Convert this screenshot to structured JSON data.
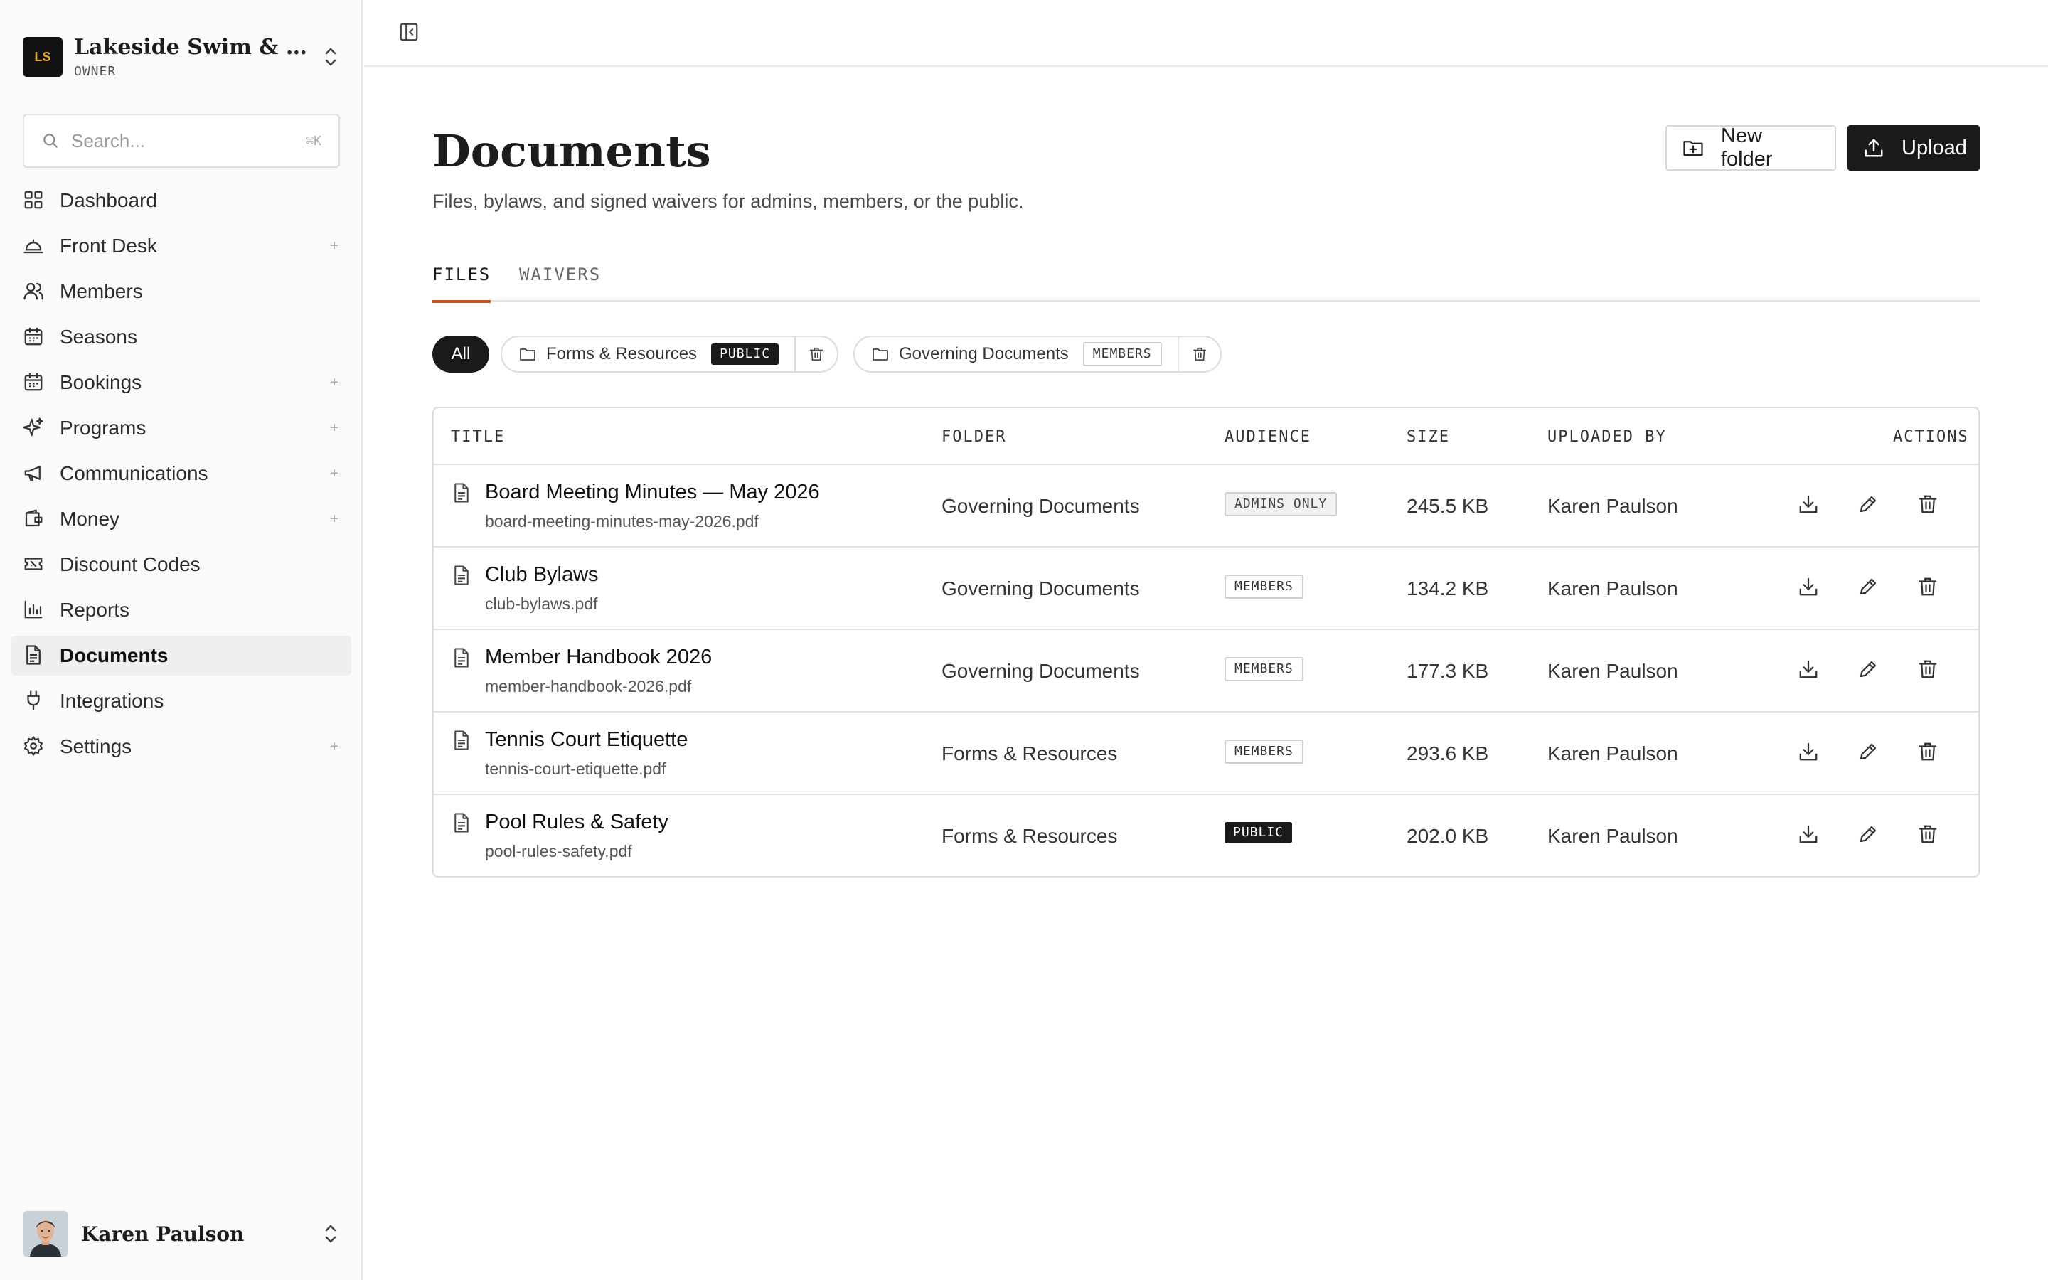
{
  "org": {
    "initials": "LS",
    "name": "Lakeside Swim & Tennis Club",
    "role": "OWNER"
  },
  "search": {
    "placeholder": "Search...",
    "shortcut": "⌘K"
  },
  "nav": [
    {
      "label": "Dashboard",
      "icon": "grid-icon",
      "plus": ""
    },
    {
      "label": "Front Desk",
      "icon": "bell-icon",
      "plus": "+"
    },
    {
      "label": "Members",
      "icon": "users-icon",
      "plus": ""
    },
    {
      "label": "Seasons",
      "icon": "calendar-icon",
      "plus": ""
    },
    {
      "label": "Bookings",
      "icon": "calendar-icon",
      "plus": "+"
    },
    {
      "label": "Programs",
      "icon": "sparkles-icon",
      "plus": "+"
    },
    {
      "label": "Communications",
      "icon": "megaphone-icon",
      "plus": "+"
    },
    {
      "label": "Money",
      "icon": "wallet-icon",
      "plus": "+"
    },
    {
      "label": "Discount Codes",
      "icon": "ticket-icon",
      "plus": ""
    },
    {
      "label": "Reports",
      "icon": "bar-chart-icon",
      "plus": ""
    },
    {
      "label": "Documents",
      "icon": "document-icon",
      "plus": ""
    },
    {
      "label": "Integrations",
      "icon": "plug-icon",
      "plus": ""
    },
    {
      "label": "Settings",
      "icon": "gear-icon",
      "plus": "+"
    }
  ],
  "user": {
    "name": "Karen Paulson"
  },
  "page": {
    "title": "Documents",
    "subtitle": "Files, bylaws, and signed waivers for admins, members, or the public.",
    "new_folder_label": "New folder",
    "upload_label": "Upload"
  },
  "tabs": [
    {
      "label": "FILES",
      "active": true
    },
    {
      "label": "WAIVERS",
      "active": false
    }
  ],
  "filters": {
    "all_label": "All",
    "folders": [
      {
        "name": "Forms & Resources",
        "audience": "PUBLIC"
      },
      {
        "name": "Governing Documents",
        "audience": "MEMBERS"
      }
    ]
  },
  "table": {
    "headers": {
      "title": "TITLE",
      "folder": "FOLDER",
      "audience": "AUDIENCE",
      "size": "SIZE",
      "uploaded_by": "UPLOADED BY",
      "actions": "ACTIONS"
    },
    "rows": [
      {
        "title": "Board Meeting Minutes — May 2026",
        "file": "board-meeting-minutes-may-2026.pdf",
        "folder": "Governing Documents",
        "audience": "ADMINS ONLY",
        "size": "245.5 KB",
        "uploaded_by": "Karen Paulson"
      },
      {
        "title": "Club Bylaws",
        "file": "club-bylaws.pdf",
        "folder": "Governing Documents",
        "audience": "MEMBERS",
        "size": "134.2 KB",
        "uploaded_by": "Karen Paulson"
      },
      {
        "title": "Member Handbook 2026",
        "file": "member-handbook-2026.pdf",
        "folder": "Governing Documents",
        "audience": "MEMBERS",
        "size": "177.3 KB",
        "uploaded_by": "Karen Paulson"
      },
      {
        "title": "Tennis Court Etiquette",
        "file": "tennis-court-etiquette.pdf",
        "folder": "Forms & Resources",
        "audience": "MEMBERS",
        "size": "293.6 KB",
        "uploaded_by": "Karen Paulson"
      },
      {
        "title": "Pool Rules & Safety",
        "file": "pool-rules-safety.pdf",
        "folder": "Forms & Resources",
        "audience": "PUBLIC",
        "size": "202.0 KB",
        "uploaded_by": "Karen Paulson"
      }
    ]
  },
  "colors": {
    "accent": "#c0561f",
    "dark": "#1a1a1a",
    "logo_text": "#e6a72e"
  }
}
